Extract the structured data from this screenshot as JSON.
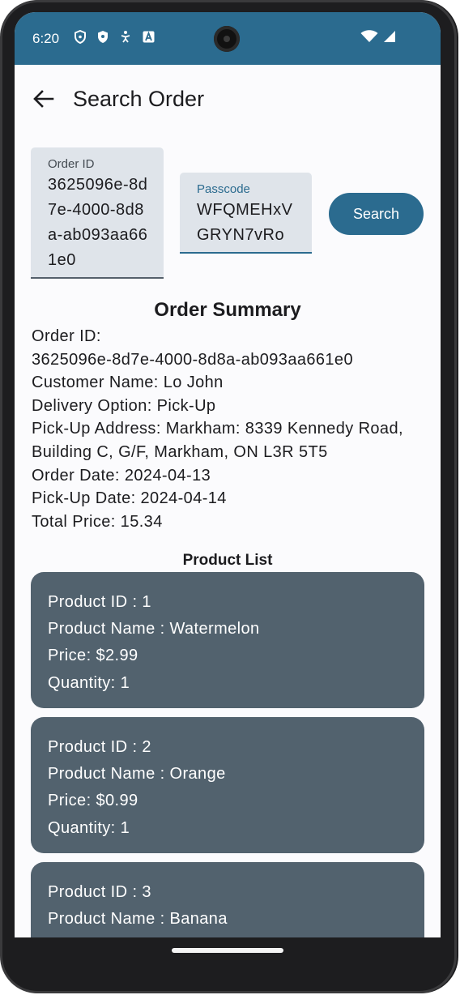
{
  "status_bar": {
    "time": "6:20",
    "icons": [
      "shield-outline-icon",
      "shield-filled-icon",
      "accessibility-icon",
      "font-icon"
    ],
    "right_icons": [
      "wifi-icon",
      "cellular-icon"
    ]
  },
  "app_bar": {
    "title": "Search Order",
    "back_icon": "arrow-back-icon"
  },
  "search": {
    "order_id_label": "Order ID",
    "order_id_value": "3625096e-8d7e-4000-8d8a-ab093aa661e0",
    "passcode_label": "Passcode",
    "passcode_value": "WFQMEHxVGRYN7vRo",
    "button_label": "Search"
  },
  "summary": {
    "title": "Order Summary",
    "order_id_label": "Order ID:",
    "order_id": "3625096e-8d7e-4000-8d8a-ab093aa661e0",
    "customer": "Customer Name: Lo John",
    "delivery": "Delivery Option: Pick-Up",
    "address_line1": "Pick-Up Address: Markham: 8339 Kennedy Road,",
    "address_line2": "Building C, G/F, Markham, ON L3R 5T5",
    "order_date": "Order Date: 2024-04-13",
    "pickup_date": "Pick-Up Date: 2024-04-14",
    "total_price": "Total Price: 15.34"
  },
  "products": {
    "title": "Product List",
    "items": [
      {
        "id": "Product ID : 1",
        "name": "Product Name : Watermelon",
        "price": "Price: $2.99",
        "quantity": "Quantity: 1"
      },
      {
        "id": "Product ID : 2",
        "name": "Product Name : Orange",
        "price": "Price: $0.99",
        "quantity": "Quantity: 1"
      },
      {
        "id": "Product ID : 3",
        "name": "Product Name : Banana",
        "price": "",
        "quantity": ""
      }
    ]
  },
  "colors": {
    "status_bar": "#2b6b8f",
    "accent": "#2b6b8f",
    "card": "#52626e",
    "field": "#dfe4ea"
  }
}
